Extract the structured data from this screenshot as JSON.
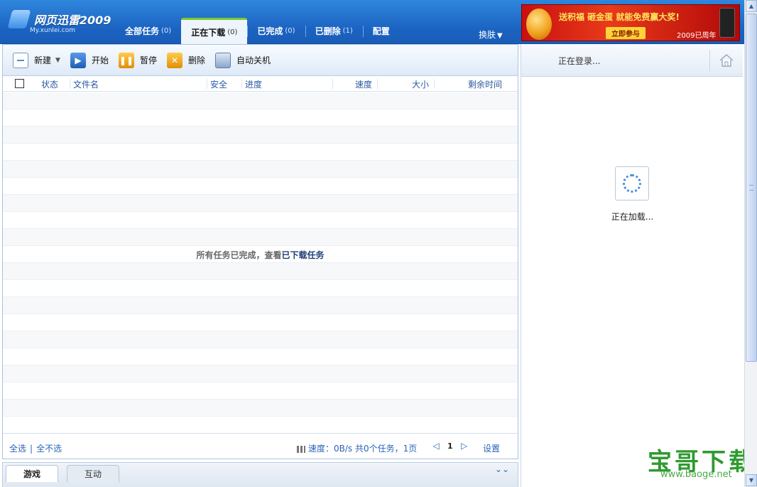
{
  "logo": {
    "title": "网页迅雷2009",
    "subtitle": "My.xunlei.com"
  },
  "tabs": [
    {
      "label": "全部任务",
      "count": "(0)"
    },
    {
      "label": "正在下载",
      "count": "(0)"
    },
    {
      "label": "已完成",
      "count": "(0)"
    },
    {
      "label": "已删除",
      "count": "(1)"
    },
    {
      "label": "配置",
      "count": ""
    }
  ],
  "skin": {
    "label": "换肤",
    "arrow": "▼"
  },
  "ad": {
    "headline": "送积福 砸金蛋 就能免费赢大奖!",
    "button": "立即参与",
    "year": "2009已周年"
  },
  "toolbar": {
    "new": "新建",
    "start": "开始",
    "pause": "暂停",
    "delete": "删除",
    "shutdown": "自动关机",
    "dropdown": "▼"
  },
  "icons": {
    "start": "▶",
    "pause": "❚❚",
    "delete": "✕"
  },
  "table": {
    "headers": {
      "status": "状态",
      "filename": "文件名",
      "security": "安全",
      "progress": "进度",
      "speed": "速度",
      "size": "大小",
      "remaining": "剩余时间"
    }
  },
  "empty": {
    "prefix": "所有任务已完成，查看",
    "link": "已下载任务"
  },
  "footer": {
    "select_all": "全选",
    "separator": "|",
    "select_none": "全不选",
    "speed_text": "速度：0B/s 共0个任务，1页",
    "prev": "◁",
    "page": "1",
    "next": "▷",
    "settings": "设置"
  },
  "bottom_tabs": {
    "games": "游戏",
    "interact": "互动",
    "collapse": "⌄⌄"
  },
  "right": {
    "login_status": "正在登录...",
    "loading": "正在加载..."
  },
  "watermark": {
    "text": "宝哥下载",
    "url": "www.baoge.net"
  },
  "scrollbar": {
    "up": "▲",
    "down": "▼"
  }
}
